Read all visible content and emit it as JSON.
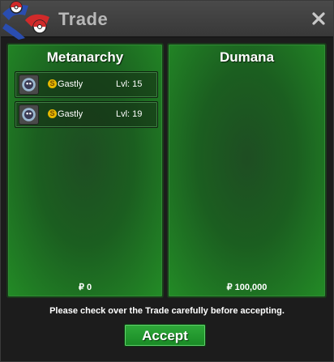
{
  "window": {
    "title": "Trade"
  },
  "trade": {
    "left": {
      "name": "Metanarchy",
      "money": "₽ 0",
      "pokemon": [
        {
          "name": "Gastly",
          "level": "Lvl: 15",
          "shiny_mark": "S",
          "icon": "gastly-sprite-icon"
        },
        {
          "name": "Gastly",
          "level": "Lvl: 19",
          "shiny_mark": "S",
          "icon": "gastly-sprite-icon"
        }
      ]
    },
    "right": {
      "name": "Dumana",
      "money": "₽ 100,000",
      "pokemon": []
    }
  },
  "footer": {
    "notice": "Please check over the Trade carefully before accepting.",
    "accept_label": "Accept"
  },
  "icons": {
    "logo": "pokeball-logo-icon",
    "close": "close-icon",
    "shiny": "shiny-coin-icon"
  },
  "colors": {
    "panel_green": "#1b5e20",
    "button_green": "#2fa93a",
    "shiny_gold": "#e6b800"
  }
}
